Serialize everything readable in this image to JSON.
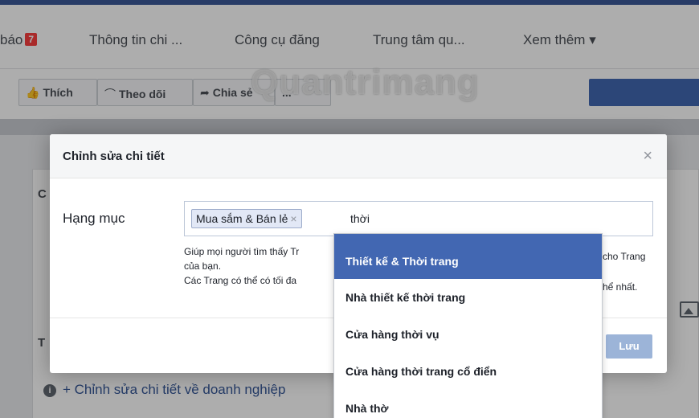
{
  "nav": {
    "items": [
      {
        "label": "báo",
        "badge": "7"
      },
      {
        "label": "Thông tin chi ..."
      },
      {
        "label": "Công cụ đăng"
      },
      {
        "label": "Trung tâm qu..."
      },
      {
        "label": "Xem thêm ▾"
      }
    ]
  },
  "actions": {
    "like": "Thích",
    "follow": "Theo dõi",
    "share": "Chia sẻ",
    "more": "..."
  },
  "watermark": "Quantrimang",
  "background": {
    "edit_details_link": "+ Chỉnh sửa chi tiết về doanh nghiệp",
    "frag_c": "C",
    "frag_t": "T"
  },
  "dialog": {
    "title": "Chỉnh sửa chi tiết",
    "close": "×",
    "field_label": "Hạng mục",
    "token": "Mua sắm & Bán lẻ",
    "token_remove": "×",
    "typed_text": "thời",
    "help_line1": "Giúp mọi người tìm thấy Tr",
    "help_line1_end": "cho Trang",
    "help_line2": "của bạn.",
    "help_line3": "Các Trang có thể có tối đa",
    "help_line3_end": "hể nhất.",
    "save": "Lưu"
  },
  "dropdown": {
    "options": [
      "Thiết kế & Thời trang",
      "Nhà thiết kế thời trang",
      "Cửa hàng thời vụ",
      "Cửa hàng thời trang cổ điển",
      "Nhà thờ"
    ],
    "selected_index": 0
  },
  "colors": {
    "brand": "#3b5998",
    "primary_button": "#4267b2",
    "save_disabled": "#9cb4d8",
    "highlight": "#4267b2"
  }
}
